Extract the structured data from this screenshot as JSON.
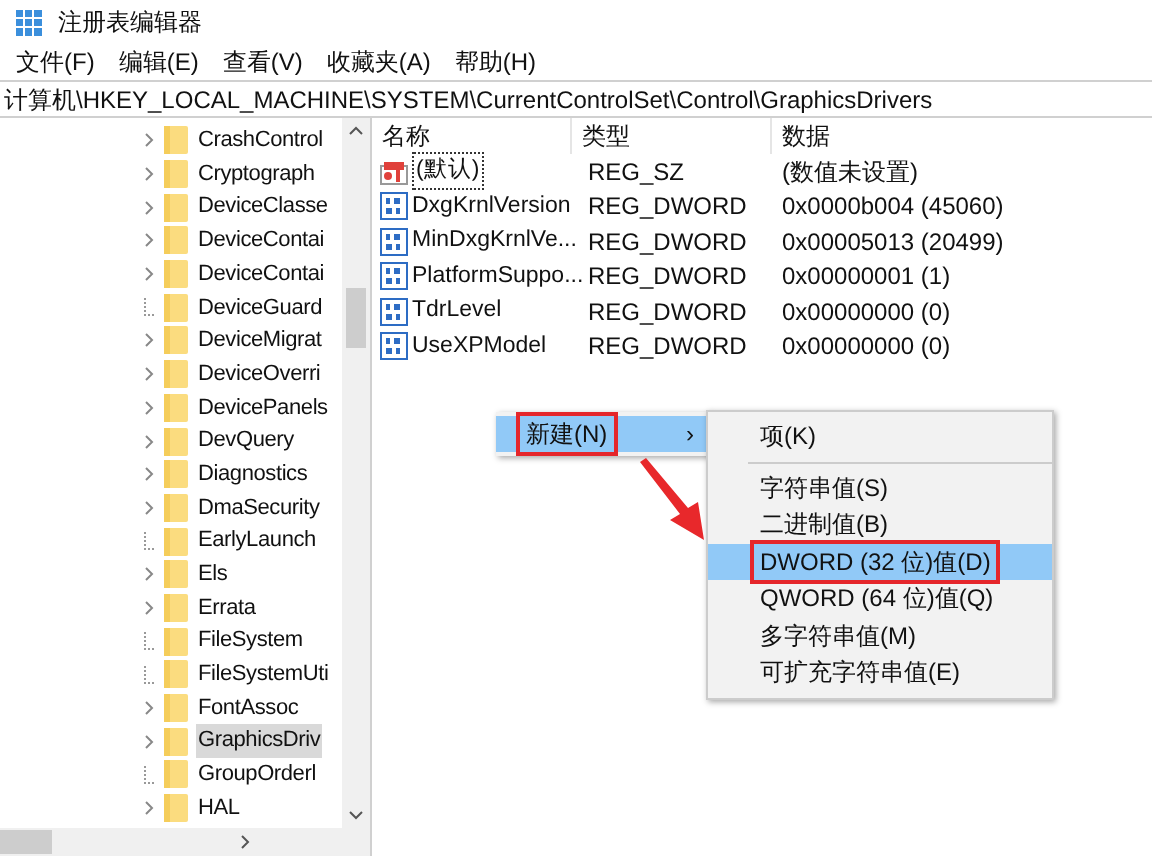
{
  "window": {
    "title": "注册表编辑器"
  },
  "menu": [
    "文件(F)",
    "编辑(E)",
    "查看(V)",
    "收藏夹(A)",
    "帮助(H)"
  ],
  "address": "计算机\\HKEY_LOCAL_MACHINE\\SYSTEM\\CurrentControlSet\\Control\\GraphicsDrivers",
  "tree": [
    {
      "label": "CrashControl",
      "kind": "arrow",
      "selected": false
    },
    {
      "label": "Cryptograph",
      "kind": "arrow",
      "selected": false
    },
    {
      "label": "DeviceClasse",
      "kind": "arrow",
      "selected": false
    },
    {
      "label": "DeviceContai",
      "kind": "arrow",
      "selected": false
    },
    {
      "label": "DeviceContai",
      "kind": "arrow",
      "selected": false
    },
    {
      "label": "DeviceGuard",
      "kind": "leaf",
      "selected": false
    },
    {
      "label": "DeviceMigrat",
      "kind": "arrow",
      "selected": false
    },
    {
      "label": "DeviceOverri",
      "kind": "arrow",
      "selected": false
    },
    {
      "label": "DevicePanels",
      "kind": "arrow",
      "selected": false
    },
    {
      "label": "DevQuery",
      "kind": "arrow",
      "selected": false
    },
    {
      "label": "Diagnostics",
      "kind": "arrow",
      "selected": false
    },
    {
      "label": "DmaSecurity",
      "kind": "arrow",
      "selected": false
    },
    {
      "label": "EarlyLaunch",
      "kind": "leaf",
      "selected": false
    },
    {
      "label": "Els",
      "kind": "arrow",
      "selected": false
    },
    {
      "label": "Errata",
      "kind": "arrow",
      "selected": false
    },
    {
      "label": "FileSystem",
      "kind": "leaf",
      "selected": false
    },
    {
      "label": "FileSystemUti",
      "kind": "leaf",
      "selected": false
    },
    {
      "label": "FontAssoc",
      "kind": "arrow",
      "selected": false
    },
    {
      "label": "GraphicsDriv",
      "kind": "arrow",
      "selected": true
    },
    {
      "label": "GroupOrderl",
      "kind": "leaf",
      "selected": false
    },
    {
      "label": "HAL",
      "kind": "arrow",
      "selected": false
    }
  ],
  "table": {
    "columns": [
      "名称",
      "类型",
      "数据"
    ],
    "rows": [
      {
        "kind": "string",
        "name": "(默认)",
        "type": "REG_SZ",
        "data": "(数值未设置)",
        "focused": true
      },
      {
        "kind": "binary",
        "name": "DxgKrnlVersion",
        "type": "REG_DWORD",
        "data": "0x0000b004 (45060)",
        "focused": false
      },
      {
        "kind": "binary",
        "name": "MinDxgKrnlVe...",
        "type": "REG_DWORD",
        "data": "0x00005013 (20499)",
        "focused": false
      },
      {
        "kind": "binary",
        "name": "PlatformSuppo...",
        "type": "REG_DWORD",
        "data": "0x00000001 (1)",
        "focused": false
      },
      {
        "kind": "binary",
        "name": "TdrLevel",
        "type": "REG_DWORD",
        "data": "0x00000000 (0)",
        "focused": false
      },
      {
        "kind": "binary",
        "name": "UseXPModel",
        "type": "REG_DWORD",
        "data": "0x00000000 (0)",
        "focused": false
      }
    ]
  },
  "context_menu": {
    "items": [
      {
        "label": "新建(N)",
        "arrow": "›",
        "selected": true,
        "annotated": true
      }
    ]
  },
  "submenu": {
    "items": [
      {
        "label": "项(K)",
        "selected": false,
        "annotated": false,
        "separator_after": true
      },
      {
        "label": "字符串值(S)",
        "selected": false,
        "annotated": false,
        "separator_after": false
      },
      {
        "label": "二进制值(B)",
        "selected": false,
        "annotated": false,
        "separator_after": false
      },
      {
        "label": "DWORD (32 位)值(D)",
        "selected": true,
        "annotated": true,
        "separator_after": false
      },
      {
        "label": "QWORD (64 位)值(Q)",
        "selected": false,
        "annotated": false,
        "separator_after": false
      },
      {
        "label": "多字符串值(M)",
        "selected": false,
        "annotated": false,
        "separator_after": false
      },
      {
        "label": "可扩充字符串值(E)",
        "selected": false,
        "annotated": false,
        "separator_after": false
      }
    ]
  }
}
